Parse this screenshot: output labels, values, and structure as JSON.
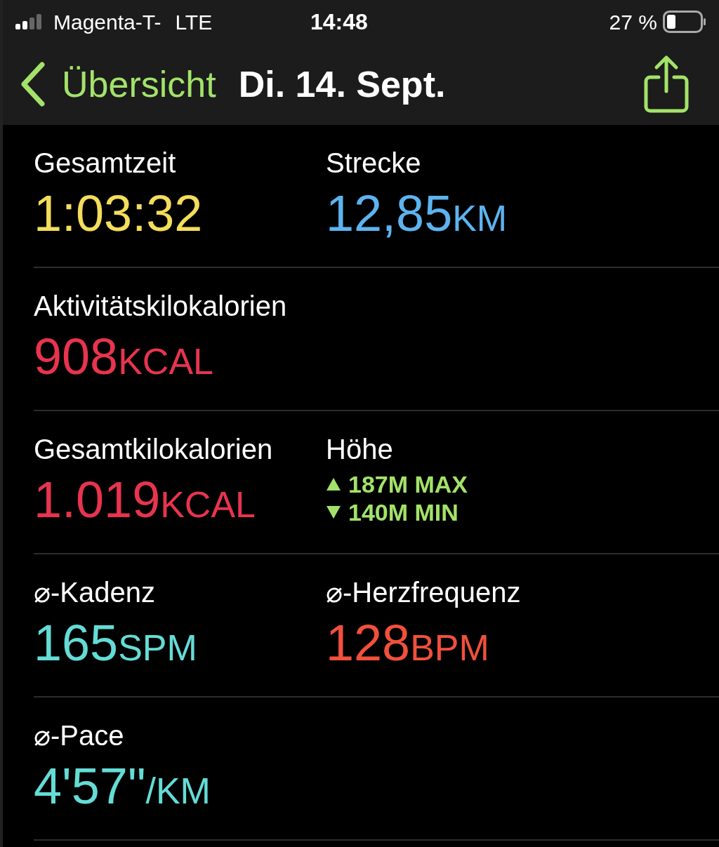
{
  "status_bar": {
    "carrier": "Magenta-T-",
    "network": "LTE",
    "time": "14:48",
    "battery": "27 %"
  },
  "nav": {
    "back": "Übersicht",
    "title": "Di. 14. Sept."
  },
  "rows": [
    {
      "cells": [
        {
          "kind": "value",
          "label": "Gesamtzeit",
          "value": "1:03:32",
          "color": "#f3dd5b"
        },
        {
          "kind": "value",
          "label": "Strecke",
          "value": "12,85",
          "unit": "KM",
          "color": "#5db3ef"
        }
      ]
    },
    {
      "cells": [
        {
          "kind": "value",
          "label": "Aktivitätskilokalorien",
          "value": "908",
          "unit": "KCAL",
          "color": "#e8344e"
        }
      ]
    },
    {
      "cells": [
        {
          "kind": "value",
          "label": "Gesamtkilokalorien",
          "value": "1.019",
          "unit": "KCAL",
          "color": "#e8344e"
        },
        {
          "kind": "elevation",
          "label": "Höhe",
          "max": "187M MAX",
          "min": "140M MIN",
          "color": "#a3e26a"
        }
      ]
    },
    {
      "cells": [
        {
          "kind": "value",
          "label": "⌀-Kadenz",
          "value": "165",
          "unit": "SPM",
          "color": "#64dcd6"
        },
        {
          "kind": "value",
          "label": "⌀-Herzfrequenz",
          "value": "128",
          "unit": "BPM",
          "color": "#f0503c"
        }
      ]
    },
    {
      "cells": [
        {
          "kind": "value",
          "label": "⌀-Pace",
          "value": "4'57\"",
          "unit": "/KM",
          "color": "#64dcd6"
        }
      ]
    }
  ]
}
